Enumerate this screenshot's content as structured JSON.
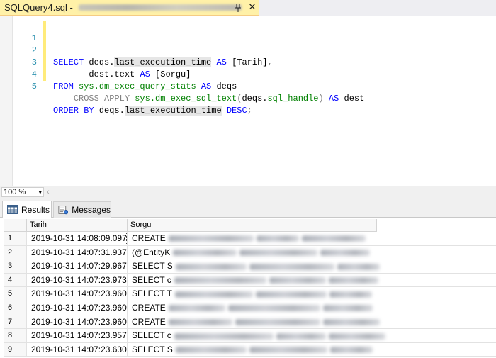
{
  "tab": {
    "title": "SQLQuery4.sql -",
    "close_glyph": "✕"
  },
  "editor": {
    "lines": [
      {
        "num": "1"
      },
      {
        "num": "2"
      },
      {
        "num": "3"
      },
      {
        "num": "4"
      },
      {
        "num": "5"
      }
    ],
    "tokens": {
      "select": "SELECT",
      "deqs_dot": "deqs.",
      "last_exec": "last_execution_time",
      "as": "AS",
      "tarih": "[Tarih]",
      "comma": ",",
      "dest_text": "dest.text",
      "sorgu": "[Sorgu]",
      "from": "FROM",
      "sys_stats": "sys.dm_exec_query_stats",
      "deqs": "deqs",
      "cross_apply": "CROSS APPLY",
      "sys_sqltext": "sys.dm_exec_sql_text",
      "open_paren": "(",
      "deqs_sqlhandle_prefix": "deqs.",
      "sql_handle": "sql_handle",
      "close_paren": ")",
      "dest": "dest",
      "order_by": "ORDER BY",
      "desc": "DESC",
      "semicolon": ";"
    }
  },
  "zoom": {
    "value": "100 %",
    "arrow": "▾",
    "scroll_arrow": "‹"
  },
  "results_tabs": {
    "results_label": "Results",
    "messages_label": "Messages"
  },
  "grid": {
    "columns": [
      "Tarih",
      "Sorgu"
    ],
    "rows": [
      {
        "n": "1",
        "tarih": "2019-10-31 14:08:09.097",
        "sorgu": "CREATE"
      },
      {
        "n": "2",
        "tarih": "2019-10-31 14:07:31.937",
        "sorgu": "(@EntityK"
      },
      {
        "n": "3",
        "tarih": "2019-10-31 14:07:29.967",
        "sorgu": "SELECT S"
      },
      {
        "n": "4",
        "tarih": "2019-10-31 14:07:23.973",
        "sorgu": "SELECT c"
      },
      {
        "n": "5",
        "tarih": "2019-10-31 14:07:23.960",
        "sorgu": "SELECT T"
      },
      {
        "n": "6",
        "tarih": "2019-10-31 14:07:23.960",
        "sorgu": "CREATE"
      },
      {
        "n": "7",
        "tarih": "2019-10-31 14:07:23.960",
        "sorgu": "CREATE"
      },
      {
        "n": "8",
        "tarih": "2019-10-31 14:07:23.957",
        "sorgu": "SELECT c"
      },
      {
        "n": "9",
        "tarih": "2019-10-31 14:07:23.630",
        "sorgu": "SELECT S"
      }
    ]
  },
  "colors": {
    "tab_active": "#fff1a8",
    "keyword": "#0000ff",
    "function": "#ff00ff",
    "system_object": "#008000",
    "line_number": "#2b91af"
  }
}
